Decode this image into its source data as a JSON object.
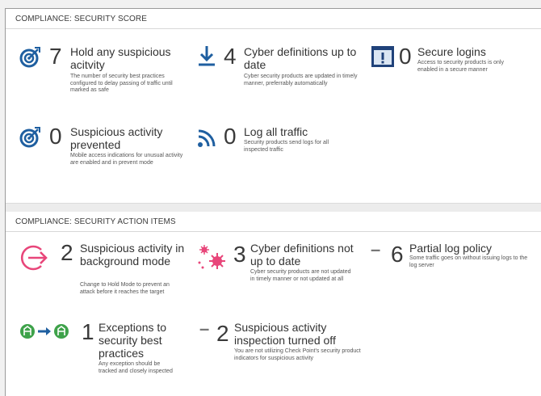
{
  "score_section": {
    "title": "COMPLIANCE: SECURITY SCORE",
    "items": [
      {
        "icon": "target-icon",
        "number": "7",
        "title": "Hold any suspicious acitvity",
        "description": "The number of security best practices configured to delay passing of traffic until marked as safe"
      },
      {
        "icon": "download-icon",
        "number": "4",
        "title": "Cyber definitions up to date",
        "description": "Cyber security products are updated in timely manner, preferrably automatically"
      },
      {
        "icon": "alert-window-icon",
        "number": "0",
        "title": "Secure logins",
        "description": "Access to security products is only enabled in a secure manner"
      },
      {
        "icon": "target-icon",
        "number": "0",
        "title": "Suspicious activity prevented",
        "description": "Mobile access indications for unusual activity are enabled and in prevent mode"
      },
      {
        "icon": "signal-icon",
        "number": "0",
        "title": "Log all traffic",
        "description": "Security products send logs for all inspected traffic"
      }
    ]
  },
  "action_section": {
    "title": "COMPLIANCE: SECURITY ACTION ITEMS",
    "items": [
      {
        "icon": "enter-arrow-icon",
        "number": "2",
        "title": "Suspicious activity in background mode",
        "description": "Change to Hold Mode to prevent an attack before it reaches the target"
      },
      {
        "icon": "virus-icon",
        "number": "3",
        "title": "Cyber definitions not up to date",
        "description": "Cyber security products are not updated in timely manner or not updated at all"
      },
      {
        "icon": "dash-icon",
        "number": "6",
        "title": "Partial log policy",
        "description": "Some traffic goes on without issuing logs to the log server"
      },
      {
        "icon": "exception-flow-icon",
        "number": "1",
        "title": "Exceptions to security best practices",
        "description": "Any exception should be tracked and closely inspected"
      },
      {
        "icon": "dash-icon",
        "number": "2",
        "title": "Suspicious activity inspection turned off",
        "description": "You are not utilizing Check Point's security product indicators for suspicious activity"
      }
    ]
  },
  "colors": {
    "blue": "#1f5fa0",
    "pink": "#e8467a",
    "green": "#3ea24a",
    "navy": "#20427a"
  }
}
